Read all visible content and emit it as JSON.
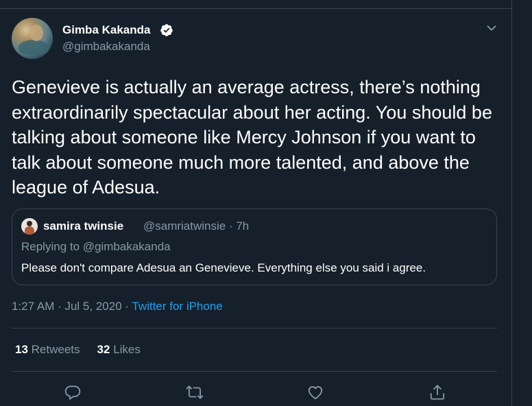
{
  "tweet": {
    "author": {
      "display_name": "Gimba Kakanda",
      "handle": "@gimbakakanda",
      "verified": true,
      "avatar_icon": "profile-photo"
    },
    "text": "Genevieve is actually an average actress, there’s nothing extraordinarily spectacular about her acting. You should be talking about someone like Mercy Johnson if you want to talk about someone much more talented, and above the league of Adesua.",
    "quoted": {
      "display_name": "samira twinsie",
      "meta": "@samriatwinsie · 7h",
      "replying_to": "Replying to @gimbakakanda",
      "text": "Please don't compare Adesua an Genevieve. Everything else you said i agree."
    },
    "timestamp": "1:27 AM · Jul 5, 2020",
    "separator": " · ",
    "source": "Twitter for iPhone",
    "stats": {
      "retweets_count": "13",
      "retweets_label": "Retweets",
      "likes_count": "32",
      "likes_label": "Likes"
    },
    "actions": [
      "reply-icon",
      "retweet-icon",
      "like-icon",
      "share-icon"
    ]
  },
  "colors": {
    "background": "#15202b",
    "border": "#38444d",
    "secondary_text": "#8899a6",
    "accent": "#1da1f2"
  }
}
